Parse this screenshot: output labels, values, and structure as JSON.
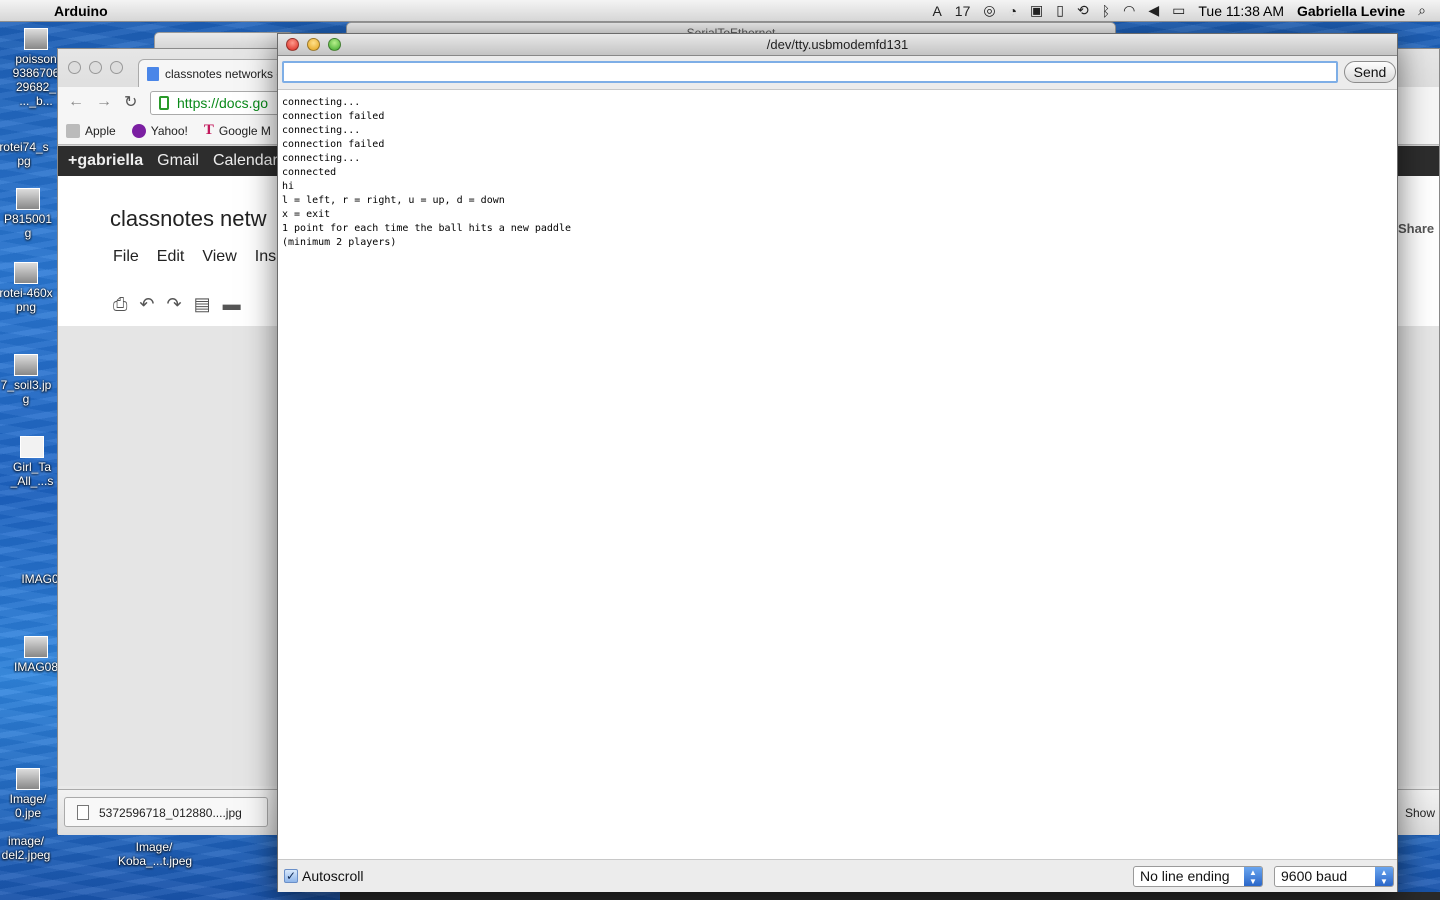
{
  "menubar": {
    "app_name": "Arduino",
    "status_text": "17",
    "clock": "Tue 11:38 AM",
    "user": "Gabriella Levine"
  },
  "desktop": {
    "icons": [
      {
        "label": "poisson\n9386706\n29682_\n..._b..."
      },
      {
        "label": "rotei74_s\npg"
      },
      {
        "label": "P815001\ng"
      },
      {
        "label": "rotei-460x\npng"
      },
      {
        "label": "7_soil3.jp\ng"
      },
      {
        "label": "Girl_Ta\n_All_...s"
      },
      {
        "label": "IMAG0"
      },
      {
        "label": "IMAG08"
      },
      {
        "label": "Image/\n0.jpe"
      },
      {
        "label": "image/\ndel2.jpeg"
      },
      {
        "label": "Image/\nKoba_...t.jpeg"
      }
    ]
  },
  "back_window": {
    "title": "SerialToEthernet"
  },
  "chrome": {
    "tab_title": "classnotes networks c",
    "url": "https://docs.go",
    "bookmarks": [
      "Apple",
      "Yahoo!",
      "Google M"
    ],
    "google_bar": [
      "+gabriella",
      "Gmail",
      "Calendar"
    ],
    "doc_title": "classnotes netw",
    "doc_menu": [
      "File",
      "Edit",
      "View",
      "Ins"
    ],
    "share_label": "Share",
    "download_file": "5372596718_012880....jpg",
    "show_all": "Show"
  },
  "serial_monitor": {
    "title": "/dev/tty.usbmodemfd131",
    "input_value": "",
    "send_label": "Send",
    "output_lines": [
      "connecting...",
      "connection failed",
      "connecting...",
      "connection failed",
      "connecting...",
      "connected",
      "hi",
      "l = left, r = right, u = up, d = down",
      "x = exit",
      "1 point for each time the ball hits a new paddle",
      "(minimum 2 players)"
    ],
    "autoscroll_label": "Autoscroll",
    "autoscroll_checked": true,
    "line_ending": "No line ending",
    "baud": "9600 baud"
  }
}
